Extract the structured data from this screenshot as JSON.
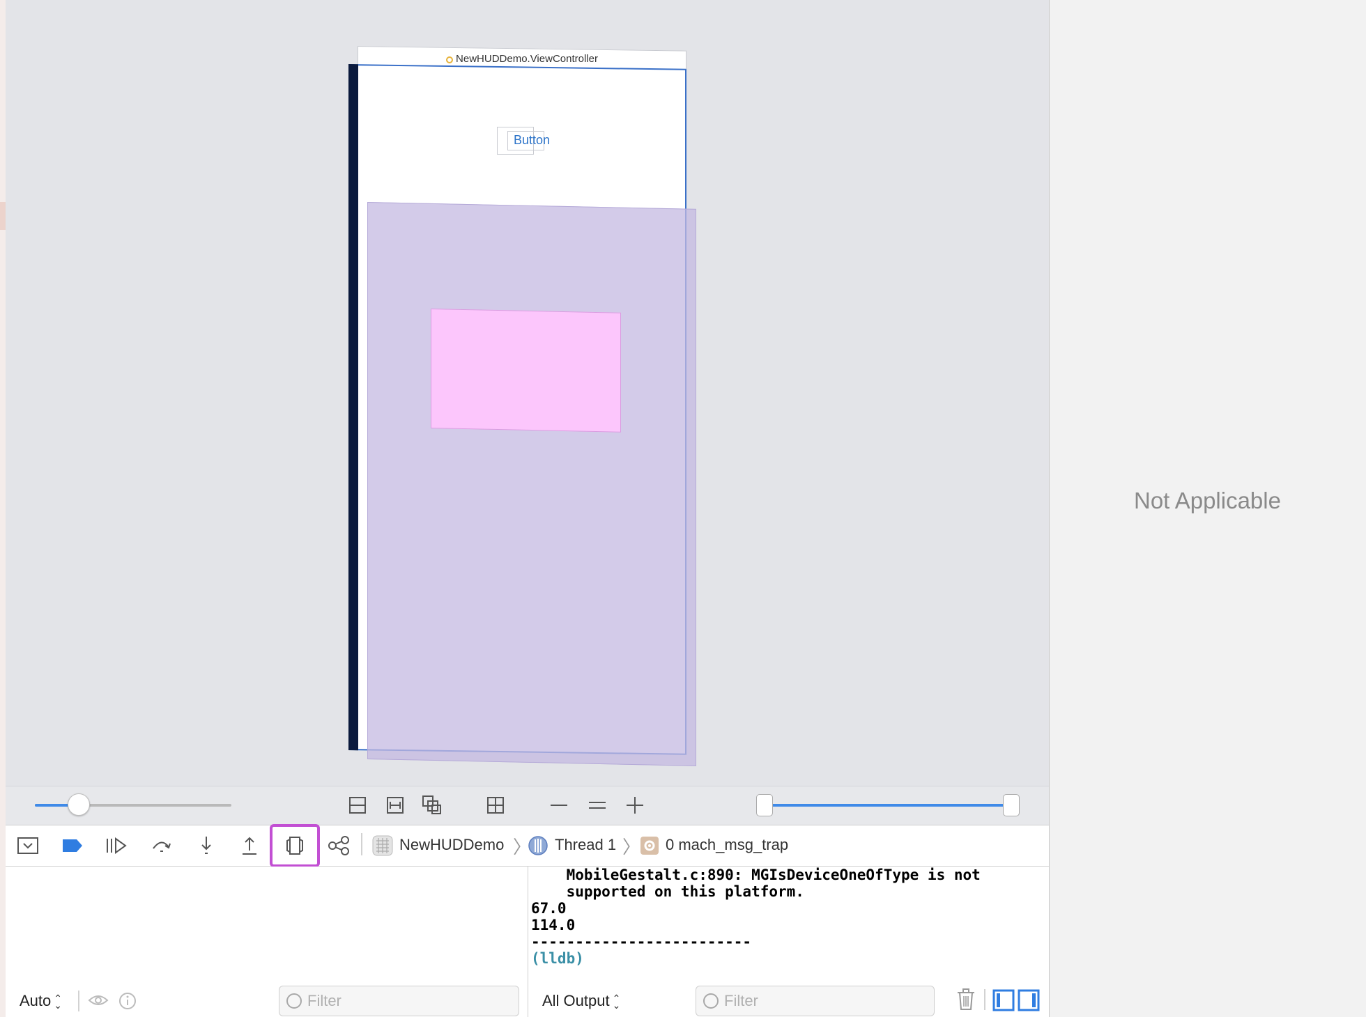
{
  "canvas": {
    "view_controller_title": "NewHUDDemo.ViewController",
    "button_label": "Button"
  },
  "inspector": {
    "placeholder": "Not Applicable"
  },
  "canvas_bar": {
    "spacing_slider_level": 0.2,
    "range_slider": [
      0.0,
      1.0
    ],
    "icons": [
      "clipped-content-icon",
      "frames-icon",
      "wireframe-contents-icon",
      "orient-grid-icon",
      "zoom-out-icon",
      "actual-size-icon",
      "zoom-in-icon"
    ]
  },
  "debug_bar": {
    "icons": [
      "hide-debug-area-icon",
      "breakpoints-toggle-icon",
      "continue-icon",
      "step-over-icon",
      "step-into-icon",
      "step-out-icon",
      "view-hierarchy-debug-icon",
      "memory-graph-icon"
    ],
    "breadcrumb": {
      "app": "NewHUDDemo",
      "thread": "Thread 1",
      "frame": "0 mach_msg_trap"
    },
    "accent_color": "#c24fd3"
  },
  "variables": {
    "scope": "Auto",
    "filter_placeholder": "Filter"
  },
  "console": {
    "lines": [
      "    MobileGestalt.c:890: MGIsDeviceOneOfType is not",
      "    supported on this platform.",
      "67.0",
      "114.0",
      "-------------------------"
    ],
    "prompt": "(lldb)",
    "output_mode": "All Output",
    "filter_placeholder": "Filter"
  }
}
